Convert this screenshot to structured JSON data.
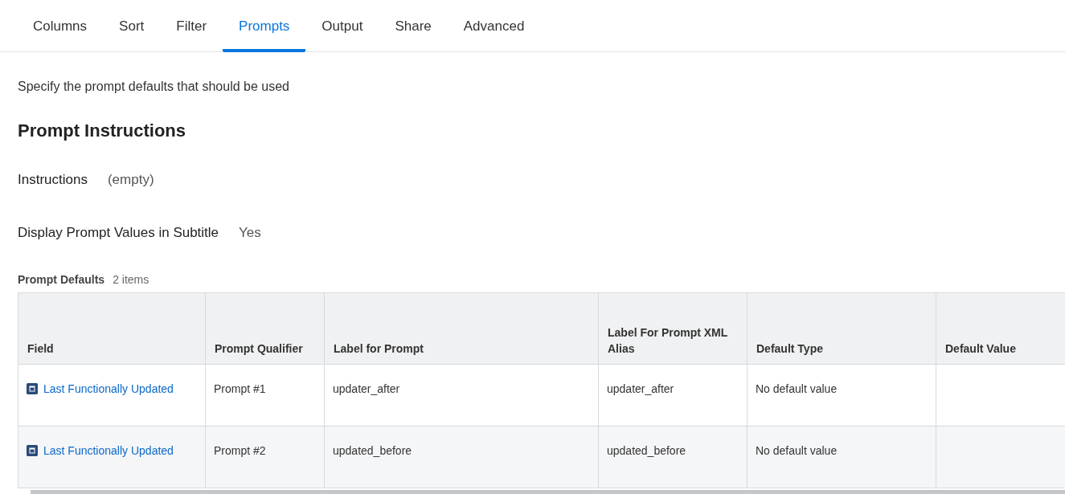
{
  "tabs": [
    {
      "label": "Columns",
      "selected": false
    },
    {
      "label": "Sort",
      "selected": false
    },
    {
      "label": "Filter",
      "selected": false
    },
    {
      "label": "Prompts",
      "selected": true
    },
    {
      "label": "Output",
      "selected": false
    },
    {
      "label": "Share",
      "selected": false
    },
    {
      "label": "Advanced",
      "selected": false
    }
  ],
  "description": "Specify the prompt defaults that should be used",
  "section_title": "Prompt Instructions",
  "fields": [
    {
      "label": "Instructions",
      "value": "(empty)"
    },
    {
      "label": "Display Prompt Values in Subtitle",
      "value": "Yes"
    }
  ],
  "table": {
    "title": "Prompt Defaults",
    "count": "2 items",
    "columns": [
      "Field",
      "Prompt Qualifier",
      "Label for Prompt",
      "Label For Prompt XML Alias",
      "Default Type",
      "Default Value"
    ],
    "rows": [
      {
        "field": "Last Functionally Updated",
        "prompt_qualifier": "Prompt #1",
        "label_for_prompt": "updater_after",
        "xml_alias": "updater_after",
        "default_type": "No default value"
      },
      {
        "field": "Last Functionally Updated",
        "prompt_qualifier": "Prompt #2",
        "label_for_prompt": "updated_before",
        "xml_alias": "updated_before",
        "default_type": "No default value"
      }
    ]
  }
}
